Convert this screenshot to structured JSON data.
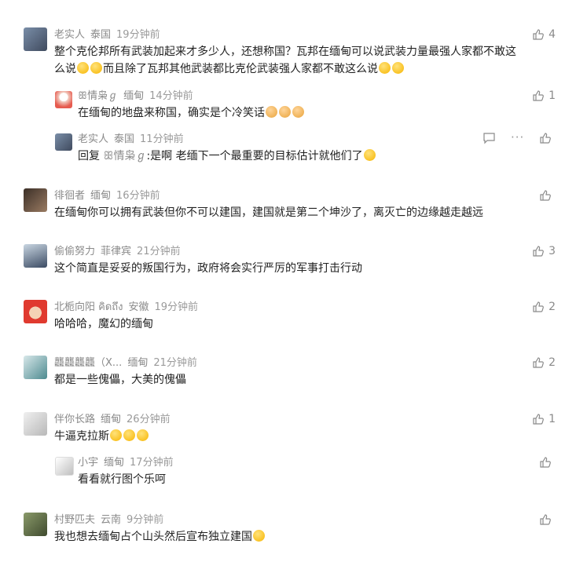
{
  "comments": [
    {
      "user": "老实人",
      "loc": "泰国",
      "time": "19分钟前",
      "likes": "4",
      "text_parts": [
        "整个克伦邦所有武装加起来才多少人，还想称国？瓦邦在缅甸可以说武装力量最强人家都不敢这",
        "么说",
        "而且除了瓦邦其他武装都比克伦武装强人家都不敢这么说"
      ]
    },
    {
      "user": "ꕥ情枭ℊ",
      "loc": "缅甸",
      "time": "14分钟前",
      "likes": "1",
      "text": "在缅甸的地盘来称国，确实是个冷笑话"
    },
    {
      "user": "老实人",
      "loc": "泰国",
      "time": "11分钟前",
      "likes": "",
      "reply_prefix": "回复",
      "reply_to": "ꕥ情枭ℊ",
      "text": ":是啊 老缅下一个最重要的目标估计就他们了"
    },
    {
      "user": "徘徊者",
      "loc": "缅甸",
      "time": "16分钟前",
      "likes": "",
      "text": "在缅甸你可以拥有武装但你不可以建国，建国就是第二个坤沙了，离灭亡的边缘越走越远"
    },
    {
      "user": "偷偷努力",
      "loc": "菲律宾",
      "time": "21分钟前",
      "likes": "3",
      "text": "这个简直是妥妥的叛国行为，政府将会实行严厉的军事打击行动"
    },
    {
      "user": "北栀向阳 คิดถึง",
      "loc": "安徽",
      "time": "19分钟前",
      "likes": "2",
      "text": "哈哈哈，魔幻的缅甸"
    },
    {
      "user": "龘龘龘龘（X...",
      "loc": "缅甸",
      "time": "21分钟前",
      "likes": "2",
      "text": "都是一些傀儡，大美的傀儡"
    },
    {
      "user": "伴你长路",
      "loc": "缅甸",
      "time": "26分钟前",
      "likes": "1",
      "text": "牛逼克拉斯"
    },
    {
      "user": "小宇",
      "loc": "缅甸",
      "time": "17分钟前",
      "likes": "",
      "text": "看看就行图个乐呵"
    },
    {
      "user": "村野匹夫",
      "loc": "云南",
      "time": "9分钟前",
      "likes": "",
      "text": "我也想去缅甸占个山头然后宣布独立建国"
    }
  ],
  "icons": {
    "like": "thumbs-up-icon",
    "comment": "comment-icon",
    "more": "more-icon"
  },
  "colors": {
    "meta": "#8a8a8a",
    "text": "#222222",
    "avatar_red": "#e03a2f"
  }
}
